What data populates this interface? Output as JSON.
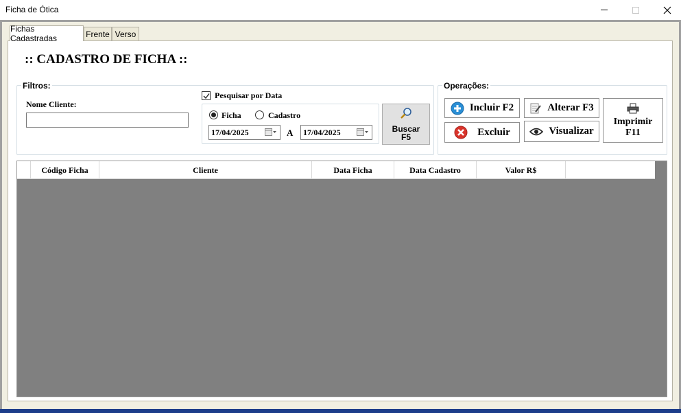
{
  "window": {
    "title": "Ficha de Ótica",
    "minimize_glyph": "",
    "close_glyph": "✕"
  },
  "tabs": [
    {
      "label": "Fichas Cadastradas",
      "active": true
    },
    {
      "label": "Frente",
      "active": false
    },
    {
      "label": "Verso",
      "active": false
    }
  ],
  "page": {
    "title": ":: CADASTRO DE FICHA ::"
  },
  "filters": {
    "legend": "Filtros:",
    "name_label": "Nome Cliente:",
    "name_value": "",
    "search_by_date_label": "Pesquisar por Data",
    "search_by_date_checked": true,
    "radio_ficha_label": "Ficha",
    "radio_ficha_selected": true,
    "radio_cadastro_label": "Cadastro",
    "radio_cadastro_selected": false,
    "date_from": "17/04/2025",
    "range_separator": "A",
    "date_to": "17/04/2025",
    "search_button_line1": "Buscar",
    "search_button_line2": "F5"
  },
  "operations": {
    "legend": "Operações:",
    "add_label": "Incluir F2",
    "edit_label": "Alterar F3",
    "print_label_line1": "Imprimir",
    "print_label_line2": "F11",
    "delete_label": "Excluir",
    "view_label": "Visualizar"
  },
  "grid": {
    "columns": [
      "Código Ficha",
      "Cliente",
      "Data Ficha",
      "Data Cadastro",
      "Valor R$"
    ],
    "rows": []
  },
  "colors": {
    "frame": "#a0a0a0",
    "panel_bg": "#f1efe2",
    "grid_empty": "#808080",
    "add_icon": "#2a8fd6",
    "delete_icon": "#d9342b"
  },
  "icons": {
    "search": "magnifier-icon",
    "add": "plus-circle-icon",
    "edit": "notepad-pencil-icon",
    "print": "printer-icon",
    "delete": "x-circle-icon",
    "view": "eye-icon",
    "calendar": "calendar-icon"
  }
}
